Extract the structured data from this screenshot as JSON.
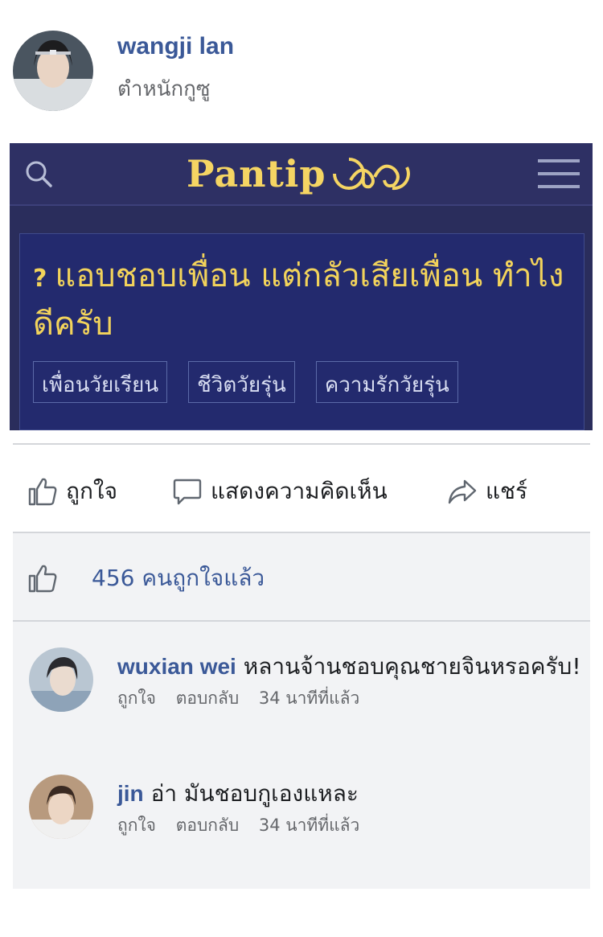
{
  "post": {
    "author_name": "wangji lan",
    "author_sub": "ตำหนักกูซู"
  },
  "shared_card": {
    "logo_text": "Pantip",
    "topic_marker": "?",
    "topic_title": "แอบชอบเพื่อน แต่กลัวเสียเพื่อน ทำไงดีครับ",
    "tags": [
      "เพื่อนวัยเรียน",
      "ชีวิตวัยรุ่น",
      "ความรักวัยรุ่น"
    ],
    "colors": {
      "background": "#2e3064",
      "topic_box": "#232a6e",
      "accent": "#f2d35b"
    }
  },
  "actions": {
    "like_label": "ถูกใจ",
    "comment_label": "แสดงความคิดเห็น",
    "share_label": "แชร์"
  },
  "likes": {
    "summary": "456 คนถูกใจแล้ว"
  },
  "comments": [
    {
      "name": "wuxian wei",
      "text": "หลานจ้านชอบคุณชายจินหรอครับ!",
      "like_label": "ถูกใจ",
      "reply_label": "ตอบกลับ",
      "time": "34 นาทีที่แล้ว"
    },
    {
      "name": "jin",
      "text": "อ่า มันชอบกูเองแหละ",
      "like_label": "ถูกใจ",
      "reply_label": "ตอบกลับ",
      "time": "34 นาทีที่แล้ว"
    }
  ],
  "colors": {
    "link": "#3b5998",
    "meta": "#65676b",
    "lower_bg": "#f2f3f5"
  },
  "icons": [
    "search-icon",
    "hamburger-menu-icon",
    "thumbs-up-icon",
    "comment-icon",
    "share-icon"
  ]
}
